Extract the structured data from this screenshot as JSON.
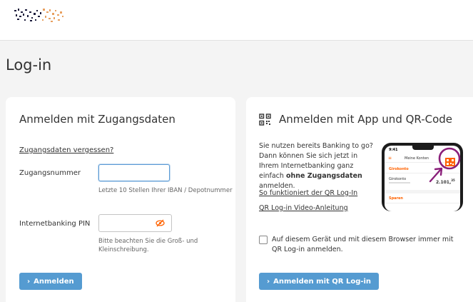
{
  "page": {
    "title": "Log-in"
  },
  "colors": {
    "button": "#559bd1",
    "accent_orange": "#ff6200",
    "highlight_purple": "#8a1f7a"
  },
  "left_card": {
    "heading": "Anmelden mit Zugangsdaten",
    "forgot_link": "Zugangsdaten vergessen?",
    "account_label": "Zugangsnummer",
    "account_value": "",
    "account_hint": "Letzte 10 Stellen Ihrer IBAN / Depotnummer",
    "pin_label": "Internetbanking PIN",
    "pin_value": "",
    "pin_hint_line1": "Bitte beachten Sie die Groß- und",
    "pin_hint_line2": "Kleinschreibung.",
    "pin_toggle_icon": "eye-slash-icon",
    "submit_label": "Anmelden"
  },
  "right_card": {
    "heading": "Anmelden mit App und QR-Code",
    "heading_icon": "qr-code-icon",
    "desc_part1": "Sie nutzen bereits Banking to go? Dann können Sie sich jetzt in Ihrem Internetbanking ganz einfach ",
    "desc_bold": "ohne Zugangsdaten",
    "desc_part2": " anmelden.",
    "link_how": "So funktioniert der QR Log-In",
    "link_video": "QR Log-in Video-Anleitung",
    "remember_label": "Auf diesem Gerät und mit diesem Browser immer mit QR Log-in anmelden.",
    "remember_checked": false,
    "submit_label": "Anmelden mit QR Log-in",
    "phone": {
      "time": "9:41",
      "screen_title": "Meine Konten",
      "account1": "Girokonto",
      "account2": "Girokonto",
      "amount": "2.101,",
      "amount_cents": "35",
      "account3": "Sparen"
    }
  }
}
